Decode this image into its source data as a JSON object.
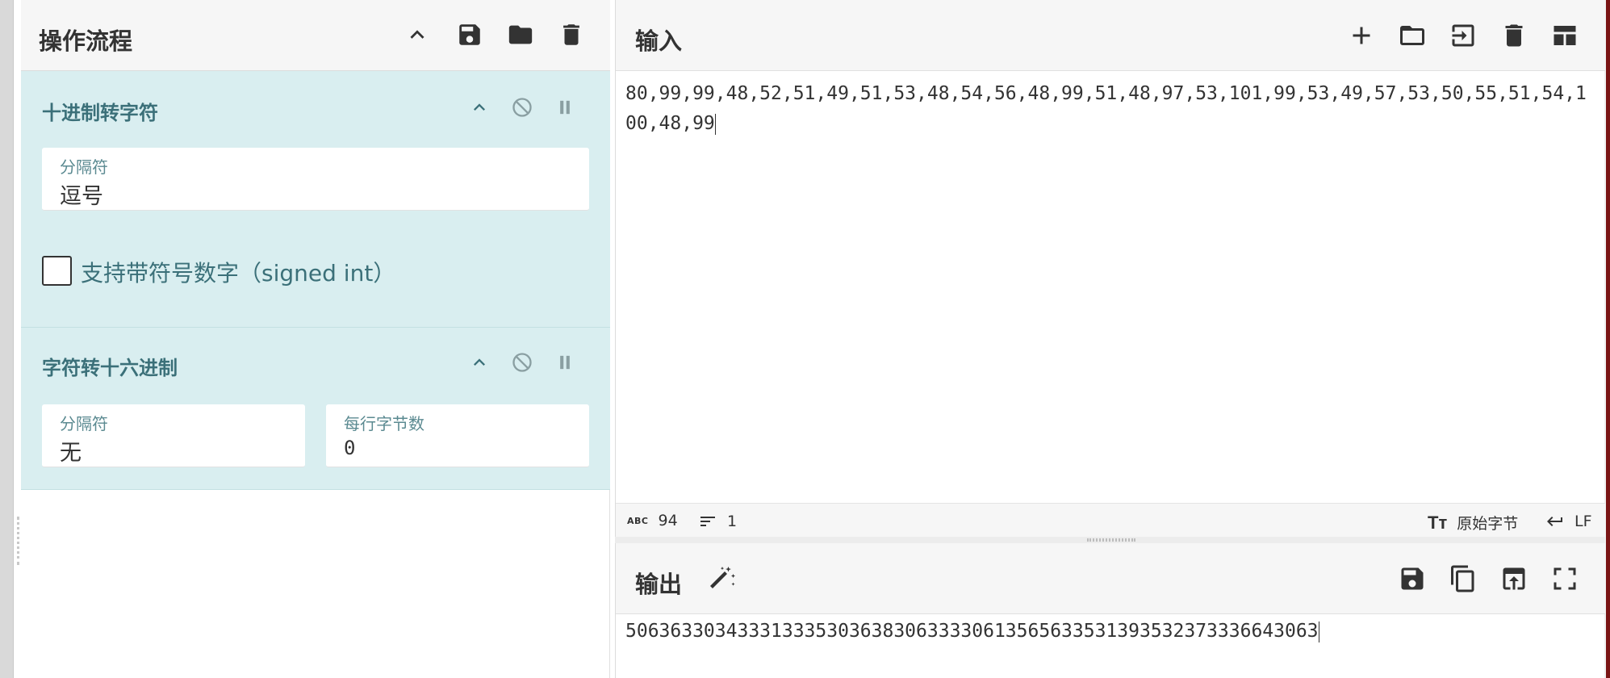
{
  "recipe": {
    "title": "操作流程",
    "operations": [
      {
        "title": "十进制转字符",
        "fields": [
          {
            "label": "分隔符",
            "value": "逗号"
          }
        ],
        "checkbox": {
          "label": "支持带符号数字（signed int）",
          "checked": false
        }
      },
      {
        "title": "字符转十六进制",
        "fields": [
          {
            "label": "分隔符",
            "value": "无"
          },
          {
            "label": "每行字节数",
            "value": "0"
          }
        ]
      }
    ]
  },
  "input": {
    "title": "输入",
    "text": "80,99,99,48,52,51,49,51,53,48,54,56,48,99,51,48,97,53,101,99,53,49,57,53,50,55,51,54,100,48,99",
    "status": {
      "char_count": "94",
      "line_count": "1",
      "encoding": "原始字节",
      "eol": "LF"
    }
  },
  "output": {
    "title": "输出",
    "text": "50636330343331333530363830633330613565633531393532373336643063"
  },
  "colors": {
    "operation_bg": "#d9eef0",
    "operation_title": "#3b7079",
    "accent_strip": "#7a1414"
  },
  "icons": {
    "recipe_header": [
      "chevron-up-icon",
      "save-icon",
      "folder-icon",
      "trash-icon"
    ],
    "operation": [
      "chevron-up-icon",
      "disable-icon",
      "pause-icon"
    ],
    "input_header": [
      "plus-icon",
      "folder-open-icon",
      "import-icon",
      "trash-icon",
      "layout-icon"
    ],
    "output_header": [
      "magic-wand-icon",
      "save-icon",
      "copy-icon",
      "replace-input-icon",
      "fullscreen-icon"
    ]
  }
}
